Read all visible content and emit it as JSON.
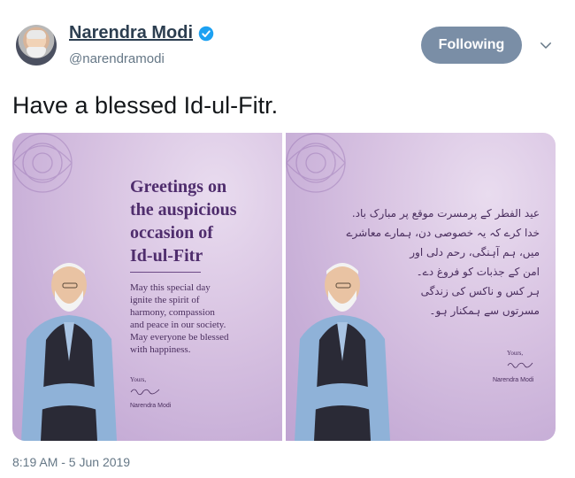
{
  "header": {
    "display_name": "Narendra Modi",
    "handle": "@narendramodi",
    "follow_label": "Following"
  },
  "tweet": {
    "text": "Have a blessed Id-ul-Fitr.",
    "timestamp": "8:19 AM - 5 Jun 2019"
  },
  "media": {
    "left_card": {
      "title_lines": [
        "Greetings on",
        "the auspicious",
        "occasion of",
        "Id-ul-Fitr"
      ],
      "body_lines": [
        "May this special day",
        "ignite the spirit of",
        "harmony, compassion",
        "and peace in our society.",
        "May everyone be blessed",
        "with happiness."
      ],
      "closing": "Yours,",
      "signer": "Narendra Modi"
    },
    "right_card": {
      "urdu_lines": [
        "عید الفطر کے پرمسرت موقع پر مبارک باد.",
        "خدا کرے کہ یہ خصوصی دن، ہمارے معاشرے",
        "میں، ہم آہنگی، رحم دلی اور",
        "امن کے جذبات کو فروغ دے۔",
        "ہر کس و ناکس کی زندگی",
        "مسرتوں سے ہمکنار ہو۔"
      ],
      "closing": "Yours,",
      "signer": "Narendra Modi"
    }
  },
  "colors": {
    "follow_bg": "#7a8ea6",
    "verified": "#1da1f2",
    "name": "#2c3e50",
    "card_title": "#4f2d6d"
  },
  "icons": {
    "verified": "verified-badge-icon",
    "more": "chevron-down-icon"
  }
}
